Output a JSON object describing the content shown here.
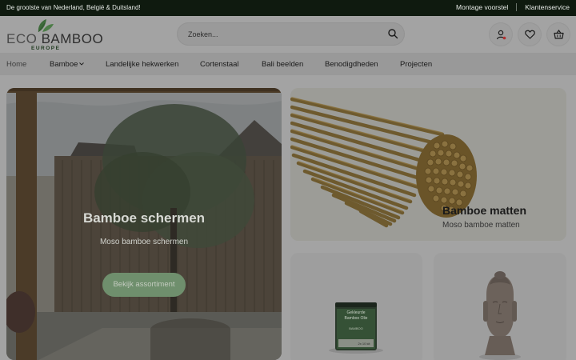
{
  "topbar": {
    "promo": "De grootste van Nederland, België & Duitsland!",
    "links": [
      "Montage voorstel",
      "Klantenservice"
    ]
  },
  "header": {
    "logo_word_eco": "ECO",
    "logo_word_bamboo": "BAMBOO",
    "logo_sub": "EUROPE",
    "search_placeholder": "Zoeken...",
    "icons": [
      "account-icon",
      "heart-icon",
      "basket-icon"
    ]
  },
  "nav": {
    "items": [
      {
        "label": "Home"
      },
      {
        "label": "Bamboe",
        "has_dropdown": true
      },
      {
        "label": "Landelijke hekwerken"
      },
      {
        "label": "Cortenstaal"
      },
      {
        "label": "Bali beelden"
      },
      {
        "label": "Benodigdheden"
      },
      {
        "label": "Projecten"
      }
    ]
  },
  "cards": {
    "hero": {
      "title": "Bamboe schermen",
      "subtitle": "Moso bamboe schermen",
      "button": "Bekijk assortiment"
    },
    "mats": {
      "title": "Bamboe matten",
      "subtitle": "Moso bamboe matten"
    },
    "paint_label": {
      "line1": "Gekleurde",
      "line2": "Bamboo Olie",
      "brand": "BAMBOO",
      "volume": "2x 10 kit"
    }
  },
  "colors": {
    "topbar_bg": "#0f1a0f",
    "overlay_gray": "#a3a3a3",
    "button_green": "#6f8f6d"
  }
}
